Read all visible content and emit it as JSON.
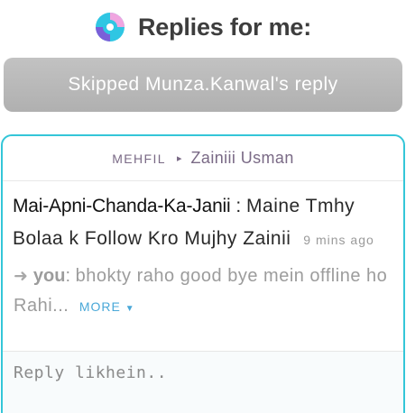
{
  "header": {
    "title": "Replies for me:",
    "logo_icon": "circular-swirl-logo"
  },
  "skip_bar": {
    "label": "Skipped Munza.Kanwal's reply"
  },
  "card": {
    "group": "MEHFIL",
    "separator": "▸",
    "recipient": "Zainiii Usman",
    "message": {
      "sender": "Mai-Apni-Chanda-Ka-Janii",
      "colon": ":",
      "text": "Maine Tmhy Bolaa k Follow Kro Mujhy Zainii",
      "time": "9 mins ago"
    },
    "previous": {
      "arrow": "➜",
      "author": "you",
      "colon": ":",
      "text": "bhokty raho good bye mein offline ho Rahi...",
      "more_label": "MORE",
      "more_caret": "▼"
    },
    "reply": {
      "placeholder": "Reply likhein.."
    }
  },
  "colors": {
    "accent_border": "#34c6d8",
    "more_link": "#4aa8d8",
    "skip_bar": "#b8b8b8"
  }
}
